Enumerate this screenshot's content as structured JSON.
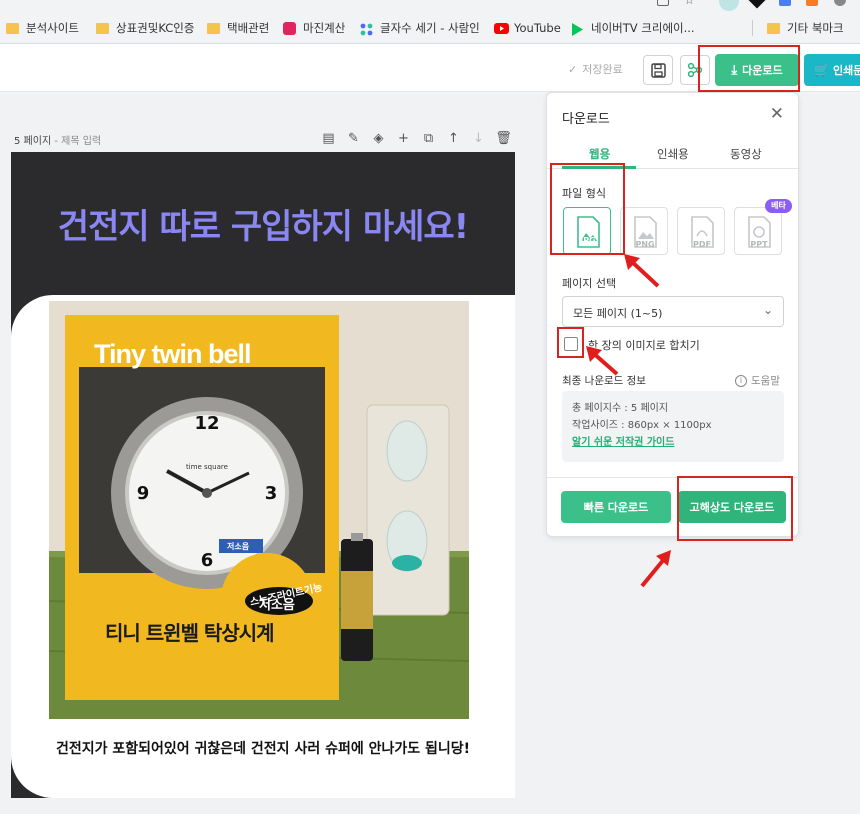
{
  "bookmarks": [
    {
      "label": "분석사이트",
      "icon": "folder-icon"
    },
    {
      "label": "상표권및KC인증",
      "icon": "folder-icon"
    },
    {
      "label": "택배관련",
      "icon": "folder-icon"
    },
    {
      "label": "마진계산",
      "icon": "margin-calc-icon"
    },
    {
      "label": "글자수 세기 - 사람인",
      "icon": "saramin-icon"
    },
    {
      "label": "YouTube",
      "icon": "youtube-icon"
    },
    {
      "label": "네이버TV 크리에이...",
      "icon": "navertv-icon"
    },
    {
      "label": "기타 북마크",
      "icon": "folder-icon"
    }
  ],
  "toolbar": {
    "saved_label": "저장완료",
    "download_label": "다운로드",
    "print_label": "인쇄문"
  },
  "editor": {
    "page_label": "5 페이지",
    "page_title_placeholder": "- 제목 입력",
    "headline": "건전지 따로 구입하지 마세요!",
    "product_brand": "Tiny twin bell",
    "product_name": "티니 트윈벨 탁상시계",
    "product_tag": "스누즈라이트기능",
    "product_badge": "저소음",
    "clock_brand": "time square",
    "clock_badge": "저소음",
    "caption": "건전지가 포함되어있어 귀찮은데 건전지 사러 슈퍼에 안나가도 됩니당!"
  },
  "panel": {
    "title": "다운로드",
    "tabs": [
      "웹용",
      "인쇄용",
      "동영상"
    ],
    "file_format_label": "파일 형식",
    "formats": [
      "JPG",
      "PNG",
      "PDF",
      "PPT"
    ],
    "beta_label": "베타",
    "page_select_label": "페이지 선택",
    "page_select_value": "모든 페이지 (1~5)",
    "merge_label": "한 장의 이미지로 합치기",
    "final_info_label": "최종 나운로드 정보",
    "help_label": "도움말",
    "total_pages": "총 페이지수 : 5 페이지",
    "work_size": "작업사이즈 : 860px × 1100px",
    "copyright_link": "알기 쉬운 저작권 가이드",
    "fast_download": "빠른 다운로드",
    "hq_download": "고해상도 다운로드"
  },
  "colors": {
    "accent": "#3cc08a",
    "headline": "#8a86f2",
    "annotation": "#d9231f"
  }
}
